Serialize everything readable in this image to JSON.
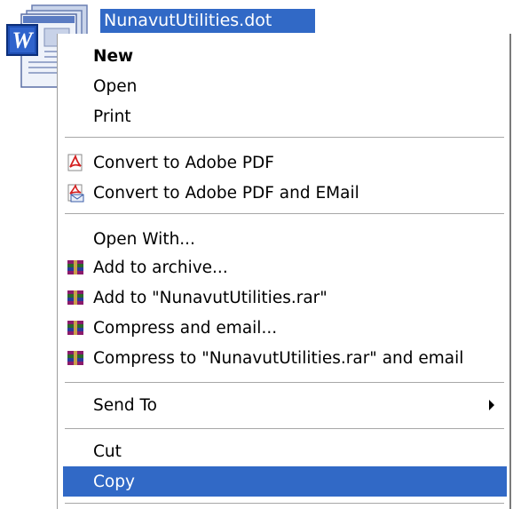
{
  "file": {
    "name": "NunavutUtilities.dot",
    "icon": "word-template-icon",
    "icon_letter": "W"
  },
  "context_menu": {
    "items": [
      {
        "id": "new",
        "label": "New",
        "icon": null
      },
      {
        "id": "open",
        "label": "Open",
        "icon": null
      },
      {
        "id": "print",
        "label": "Print",
        "icon": null
      },
      {
        "id": "convert-pdf",
        "label": "Convert to Adobe PDF",
        "icon": "adobe-pdf-icon"
      },
      {
        "id": "convert-pdf-email",
        "label": "Convert to Adobe PDF and EMail",
        "icon": "adobe-pdf-email-icon"
      },
      {
        "id": "open-with",
        "label": "Open With...",
        "icon": null
      },
      {
        "id": "add-archive",
        "label": "Add to archive...",
        "icon": "winrar-icon"
      },
      {
        "id": "add-rar",
        "label": "Add to \"NunavutUtilities.rar\"",
        "icon": "winrar-icon"
      },
      {
        "id": "compress-email",
        "label": "Compress and email...",
        "icon": "winrar-icon"
      },
      {
        "id": "compress-rar-email",
        "label": "Compress to \"NunavutUtilities.rar\" and email",
        "icon": "winrar-icon"
      },
      {
        "id": "send-to",
        "label": "Send To",
        "icon": null
      },
      {
        "id": "cut",
        "label": "Cut",
        "icon": null
      },
      {
        "id": "copy",
        "label": "Copy",
        "icon": null
      }
    ]
  },
  "colors": {
    "selection": "#3169c6",
    "separator": "#a7a7a7"
  }
}
